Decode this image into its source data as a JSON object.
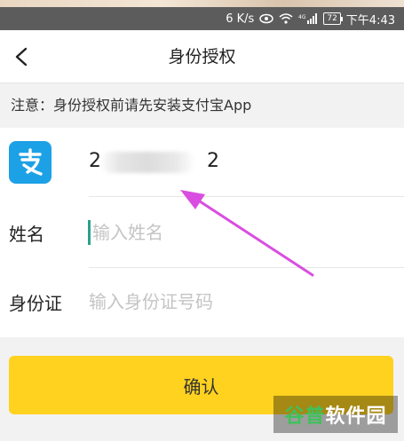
{
  "status_bar": {
    "speed": "6 K/s",
    "battery": "72",
    "time": "下午4:43"
  },
  "header": {
    "title": "身份授权"
  },
  "notice": "注意：身份授权前请先安装支付宝App",
  "form": {
    "account_start": "2",
    "account_end": "2",
    "name_label": "姓名",
    "name_placeholder": "输入姓名",
    "id_label": "身份证",
    "id_placeholder": "输入身份证号码"
  },
  "confirm_button": "确认",
  "watermark": {
    "part1": "谷普",
    "part2": "软件园"
  },
  "colors": {
    "accent": "#ffd21f",
    "alipay_blue": "#1da1e6",
    "arrow": "#d94ee0"
  }
}
